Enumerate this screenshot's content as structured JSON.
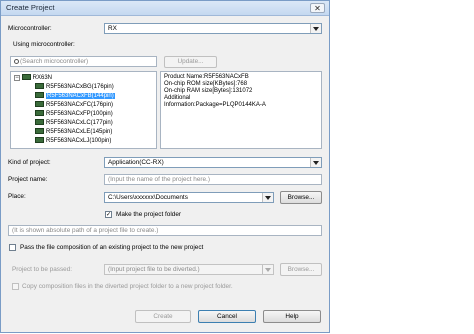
{
  "window": {
    "title": "Create Project",
    "close_glyph": "✕"
  },
  "microcontroller": {
    "label": "Microcontroller:",
    "value": "RX"
  },
  "using": {
    "label": "Using microcontroller:"
  },
  "search": {
    "placeholder": "(Search microcontroller)"
  },
  "update_button": "Update...",
  "tree": {
    "expander": "−",
    "root": "RX63N",
    "items": [
      "R5F563NACxBG(176pin)",
      "R5F563NACxFB(144pin)",
      "R5F563NACxFC(176pin)",
      "R5F563NACxFP(100pin)",
      "R5F563NACxLC(177pin)",
      "R5F563NACxLE(145pin)",
      "R5F563NACxLJ(100pin)"
    ]
  },
  "info_lines": [
    "Product Name:R5F563NACxFB",
    "On-chip ROM size[KBytes]:768",
    "On-chip RAM size[Bytes]:131072",
    "Additional",
    "Information:Package=PLQP0144KA-A"
  ],
  "kind": {
    "label": "Kind of project:",
    "value": "Application(CC-RX)"
  },
  "project_name": {
    "label": "Project name:",
    "placeholder": "(Input the name of the project here.)"
  },
  "place": {
    "label": "Place:",
    "value": "C:\\Users\\xxxxxx\\Documents",
    "browse": "Browse..."
  },
  "make_folder": {
    "label": "Make the project folder",
    "checked": true,
    "check_glyph": "✓"
  },
  "path_display": "(It is shown absolute path of a project file to create.)",
  "pass_composition": {
    "label": "Pass the file composition of an existing project to the new project",
    "checked": false
  },
  "passed": {
    "label": "Project to be passed:",
    "placeholder": "(Input project file to be diverted.)",
    "browse": "Browse..."
  },
  "copy_files": {
    "label": "Copy composition files in the diverted project folder to a new project folder.",
    "checked": false
  },
  "footer": {
    "create": "Create",
    "cancel": "Cancel",
    "help": "Help"
  }
}
